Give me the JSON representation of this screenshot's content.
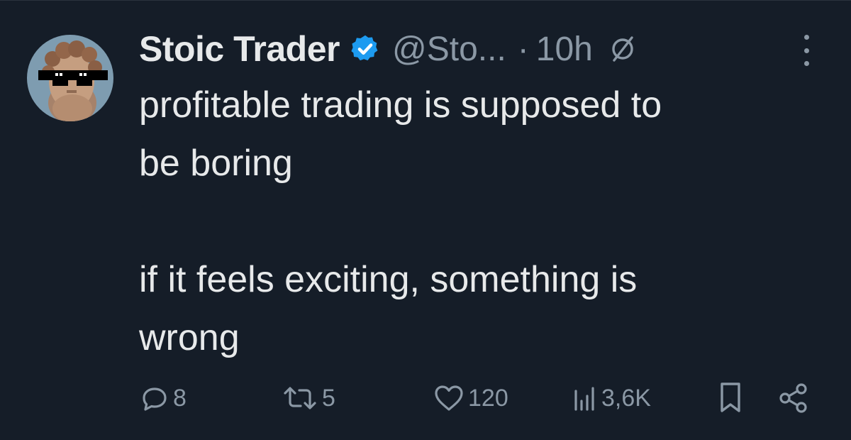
{
  "tweet": {
    "author_name": "Stoic Trader",
    "handle": "@Sto...",
    "separator": "·",
    "time": "10h",
    "text_lines": {
      "p1_line1": "profitable trading is supposed to",
      "p1_line2": "be boring",
      "p2_line1": "if it feels exciting, something is",
      "p2_line2": "wrong"
    }
  },
  "actions": {
    "replies": "8",
    "reposts": "5",
    "likes": "120",
    "views": "3,6K"
  },
  "icons": {
    "avatar": "avatar-stoic-bust-sunglasses",
    "verified": "verified-badge-icon",
    "globe": "globe-icon",
    "more": "more-dots-icon",
    "reply": "reply-icon",
    "repost": "repost-icon",
    "like": "heart-icon",
    "views": "views-chart-icon",
    "bookmark": "bookmark-icon",
    "share": "share-icon"
  },
  "colors": {
    "background": "#151d28",
    "text_primary": "#e7e9ea",
    "text_secondary": "#8b98a5",
    "verified_blue": "#1d9bf0"
  }
}
